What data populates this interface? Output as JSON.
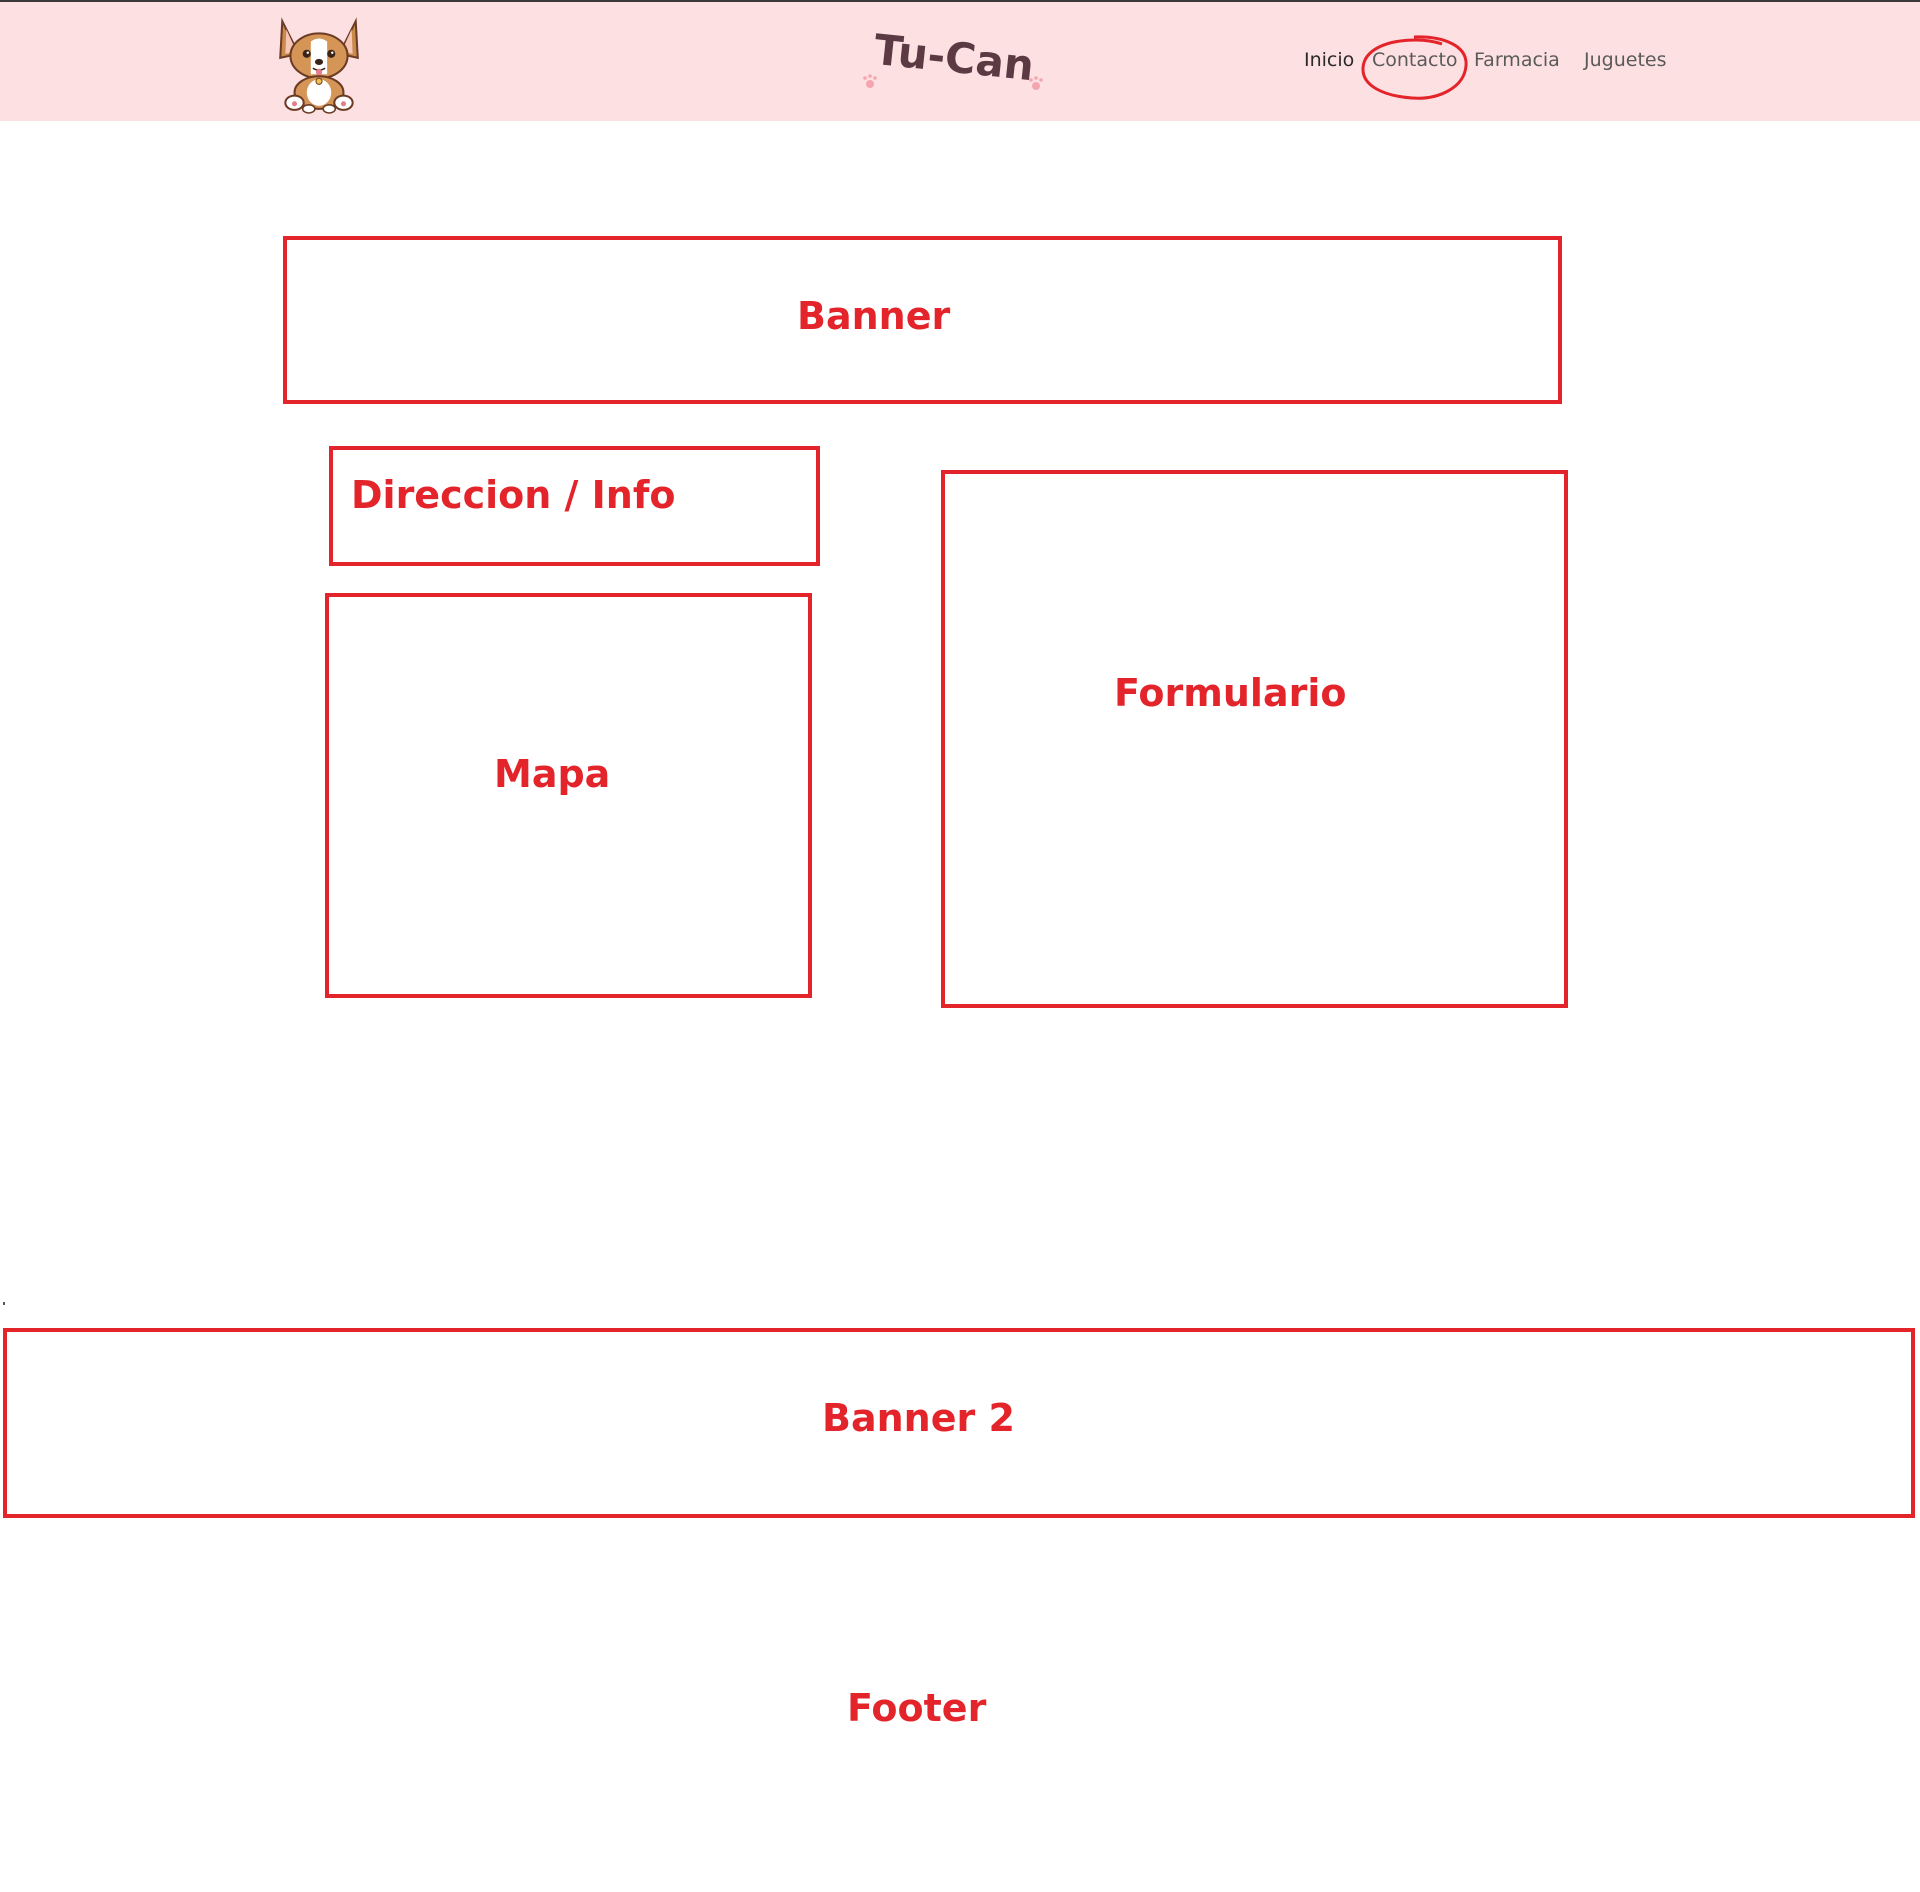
{
  "brand": {
    "name": "Tu-Can"
  },
  "nav": {
    "items": [
      {
        "label": "Inicio"
      },
      {
        "label": "Contacto"
      },
      {
        "label": "Farmacia"
      },
      {
        "label": "Juguetes"
      }
    ]
  },
  "sections": {
    "banner": "Banner",
    "direccion": "Direccion / Info",
    "mapa": "Mapa",
    "formulario": "Formulario",
    "banner2": "Banner 2",
    "footer": "Footer"
  },
  "colors": {
    "header_bg": "#fde0e2",
    "annotation_red": "#e3242b",
    "brand_text": "#5b3a44"
  },
  "icons": {
    "logo": "corgi-dog-logo-icon",
    "highlight": "hand-drawn-circle-annotation"
  }
}
